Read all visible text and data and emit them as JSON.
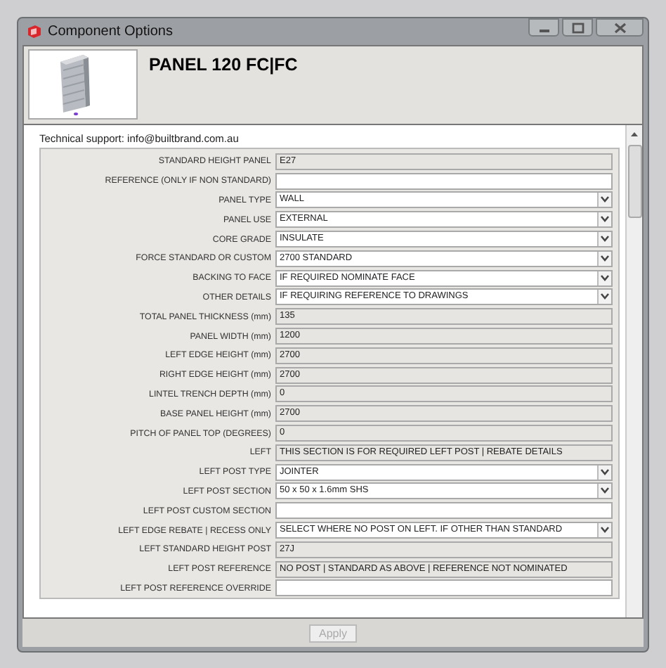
{
  "window": {
    "title": "Component Options"
  },
  "header": {
    "title": "PANEL 120 FC|FC"
  },
  "support": "Technical support: info@builtbrand.com.au",
  "fields": [
    {
      "label": "STANDARD HEIGHT PANEL",
      "kind": "readonly",
      "value": "E27"
    },
    {
      "label": "REFERENCE (ONLY IF NON STANDARD)",
      "kind": "text"
    },
    {
      "label": "PANEL TYPE",
      "kind": "select",
      "value": "WALL"
    },
    {
      "label": "PANEL USE",
      "kind": "select",
      "value": "EXTERNAL"
    },
    {
      "label": "CORE GRADE",
      "kind": "select",
      "value": "INSULATE"
    },
    {
      "label": "FORCE STANDARD OR CUSTOM",
      "kind": "select",
      "value": "2700 STANDARD"
    },
    {
      "label": "BACKING TO FACE",
      "kind": "select",
      "value": "IF REQUIRED NOMINATE FACE"
    },
    {
      "label": "OTHER DETAILS",
      "kind": "select",
      "value": "IF REQUIRING REFERENCE TO DRAWINGS"
    },
    {
      "label": "TOTAL PANEL THICKNESS (mm)",
      "kind": "readonly",
      "value": "135"
    },
    {
      "label": "PANEL WIDTH (mm)",
      "kind": "readonly",
      "value": "1200"
    },
    {
      "label": "LEFT EDGE HEIGHT (mm)",
      "kind": "readonly",
      "value": "2700"
    },
    {
      "label": "RIGHT EDGE HEIGHT (mm)",
      "kind": "readonly",
      "value": "2700"
    },
    {
      "label": "LINTEL TRENCH DEPTH (mm)",
      "kind": "readonly",
      "value": "0"
    },
    {
      "label": "BASE PANEL HEIGHT (mm)",
      "kind": "readonly",
      "value": "2700"
    },
    {
      "label": "PITCH OF PANEL TOP (DEGREES)",
      "kind": "readonly",
      "value": "0"
    },
    {
      "label": "LEFT",
      "kind": "readonly",
      "value": "THIS SECTION IS FOR REQUIRED LEFT POST | REBATE DETAILS"
    },
    {
      "label": "LEFT POST TYPE",
      "kind": "select",
      "value": "JOINTER"
    },
    {
      "label": "LEFT POST SECTION",
      "kind": "select",
      "value": "50 x 50 x 1.6mm SHS"
    },
    {
      "label": "LEFT POST CUSTOM SECTION",
      "kind": "text"
    },
    {
      "label": "LEFT EDGE REBATE | RECESS ONLY",
      "kind": "select",
      "value": "SELECT WHERE NO POST ON LEFT. IF OTHER THAN STANDARD"
    },
    {
      "label": "LEFT STANDARD HEIGHT POST",
      "kind": "readonly",
      "value": "27J"
    },
    {
      "label": "LEFT POST REFERENCE",
      "kind": "readonly",
      "value": "NO POST | STANDARD AS ABOVE | REFERENCE NOT NOMINATED"
    },
    {
      "label": "LEFT POST REFERENCE OVERRIDE",
      "kind": "text"
    }
  ],
  "apply_button": {
    "label": "Apply",
    "disabled": true
  }
}
